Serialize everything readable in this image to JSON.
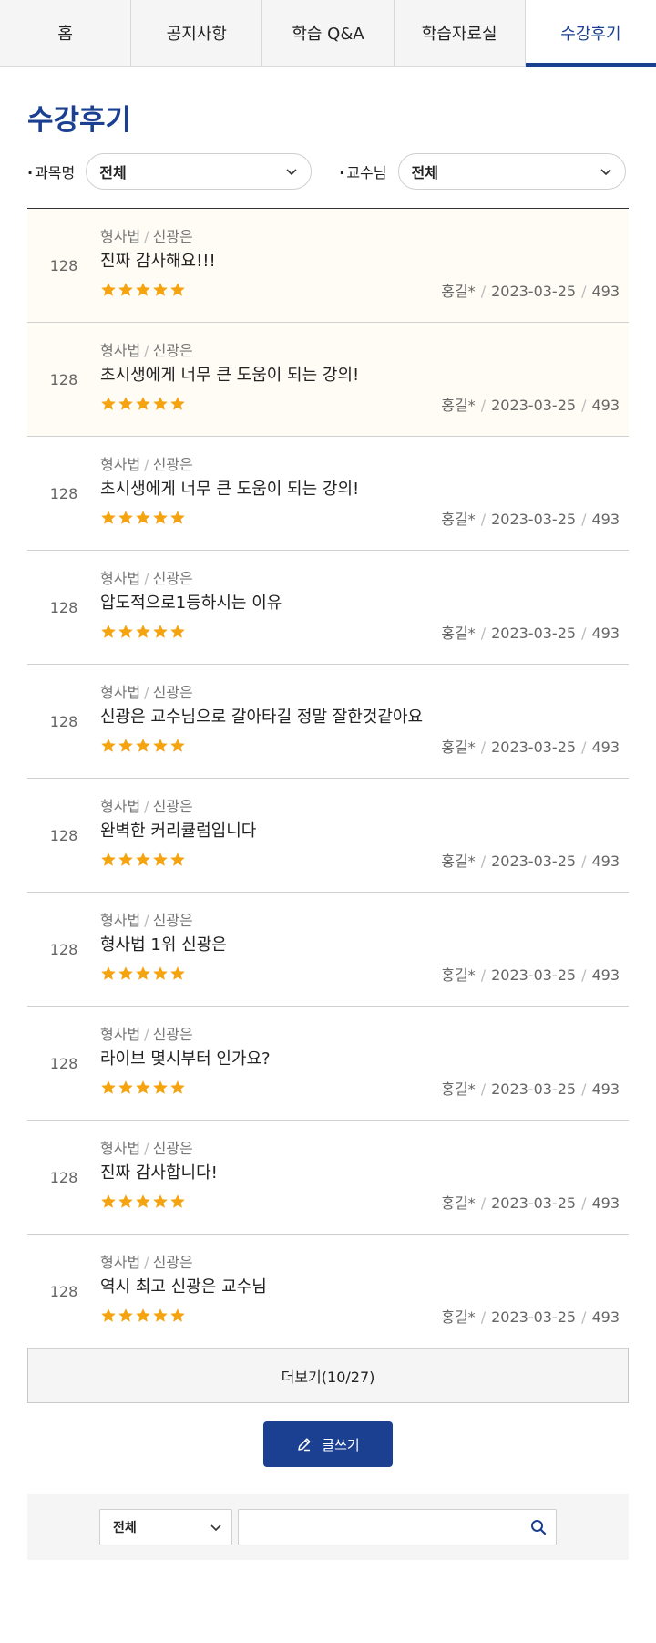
{
  "tabs": [
    {
      "label": "홈"
    },
    {
      "label": "공지사항"
    },
    {
      "label": "학습 Q&A"
    },
    {
      "label": "학습자료실"
    },
    {
      "label": "수강후기"
    }
  ],
  "page": {
    "title": "수강후기"
  },
  "filters": {
    "subject_label": "과목명",
    "subject_value": "전체",
    "professor_label": "교수님",
    "professor_value": "전체"
  },
  "reviews": [
    {
      "num": "128",
      "subject": "형사법",
      "teacher": "신광은",
      "title": "진짜 감사해요!!!",
      "rating": 5,
      "author": "홍길*",
      "date": "2023-03-25",
      "views": "493"
    },
    {
      "num": "128",
      "subject": "형사법",
      "teacher": "신광은",
      "title": "초시생에게 너무 큰 도움이 되는 강의!",
      "rating": 5,
      "author": "홍길*",
      "date": "2023-03-25",
      "views": "493"
    },
    {
      "num": "128",
      "subject": "형사법",
      "teacher": "신광은",
      "title": "초시생에게 너무 큰 도움이 되는 강의!",
      "rating": 5,
      "author": "홍길*",
      "date": "2023-03-25",
      "views": "493"
    },
    {
      "num": "128",
      "subject": "형사법",
      "teacher": "신광은",
      "title": "압도적으로1등하시는 이유",
      "rating": 5,
      "author": "홍길*",
      "date": "2023-03-25",
      "views": "493"
    },
    {
      "num": "128",
      "subject": "형사법",
      "teacher": "신광은",
      "title": "신광은 교수님으로 갈아타길 정말 잘한것같아요",
      "rating": 5,
      "author": "홍길*",
      "date": "2023-03-25",
      "views": "493"
    },
    {
      "num": "128",
      "subject": "형사법",
      "teacher": "신광은",
      "title": "완벽한 커리큘럼입니다",
      "rating": 5,
      "author": "홍길*",
      "date": "2023-03-25",
      "views": "493"
    },
    {
      "num": "128",
      "subject": "형사법",
      "teacher": "신광은",
      "title": "형사법 1위 신광은",
      "rating": 5,
      "author": "홍길*",
      "date": "2023-03-25",
      "views": "493"
    },
    {
      "num": "128",
      "subject": "형사법",
      "teacher": "신광은",
      "title": "라이브 몇시부터 인가요?",
      "rating": 5,
      "author": "홍길*",
      "date": "2023-03-25",
      "views": "493"
    },
    {
      "num": "128",
      "subject": "형사법",
      "teacher": "신광은",
      "title": "진짜 감사합니다!",
      "rating": 5,
      "author": "홍길*",
      "date": "2023-03-25",
      "views": "493"
    },
    {
      "num": "128",
      "subject": "형사법",
      "teacher": "신광은",
      "title": "역시 최고 신광은 교수님",
      "rating": 5,
      "author": "홍길*",
      "date": "2023-03-25",
      "views": "493"
    }
  ],
  "more_button": {
    "label": "더보기(10/27)"
  },
  "write_button": {
    "label": "글쓰기"
  },
  "search": {
    "select_value": "전체",
    "query": ""
  },
  "colors": {
    "accent": "#1b3f91",
    "star": "#f5a30f",
    "highlight_row": "#fefcf5"
  },
  "icons": {
    "star": "star-icon",
    "pencil": "pencil-icon",
    "search": "search-icon",
    "chevron": "chevron-down-icon"
  }
}
